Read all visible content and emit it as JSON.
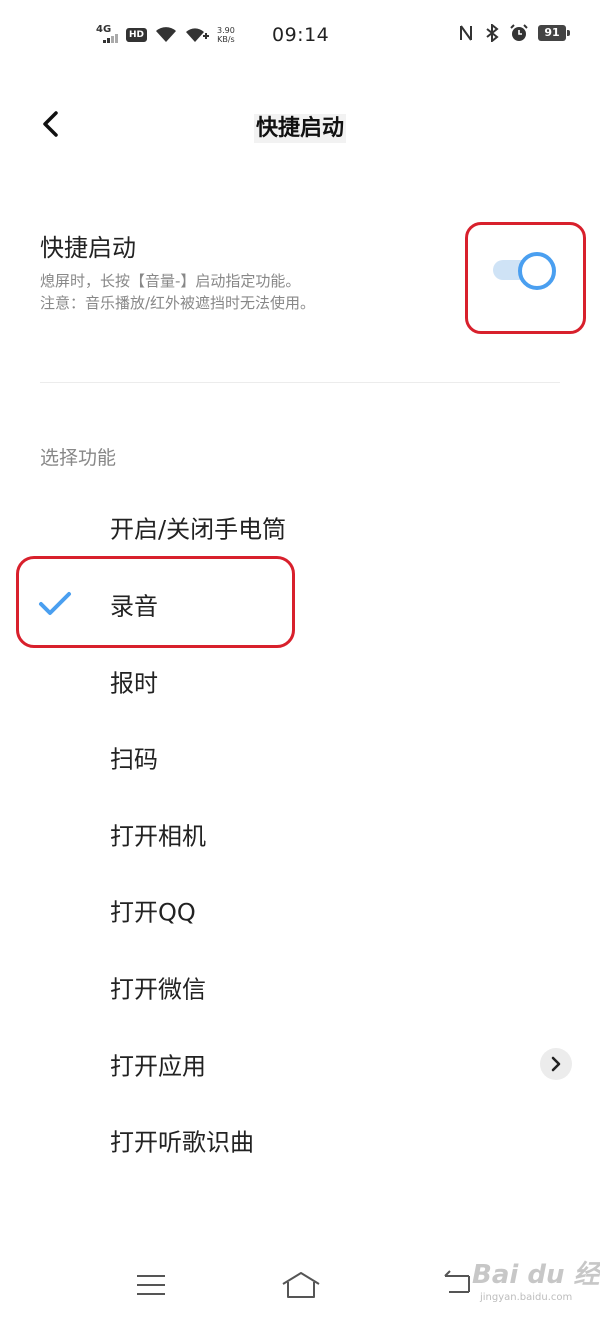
{
  "status_bar": {
    "network": "4G",
    "hd": "HD",
    "speed_value": "3.90",
    "speed_unit": "KB/s",
    "time": "09:14",
    "battery": "91"
  },
  "header": {
    "title": "快捷启动"
  },
  "quick_launch": {
    "title": "快捷启动",
    "desc_line1": "熄屏时，长按【音量-】启动指定功能。",
    "desc_line2": "注意：音乐播放/红外被遮挡时无法使用。",
    "enabled": true
  },
  "section_label": "选择功能",
  "options": [
    {
      "label": "开启/关闭手电筒"
    },
    {
      "label": "录音",
      "selected": true
    },
    {
      "label": "报时"
    },
    {
      "label": "扫码"
    },
    {
      "label": "打开相机"
    },
    {
      "label": "打开QQ"
    },
    {
      "label": "打开微信"
    },
    {
      "label": "打开应用",
      "has_chevron": true
    },
    {
      "label": "打开听歌识曲"
    }
  ],
  "watermark": {
    "brand": "Bai du 经验",
    "url": "jingyan.baidu.com"
  },
  "colors": {
    "accent": "#4a9ff0",
    "highlight_box": "#d8202c"
  }
}
